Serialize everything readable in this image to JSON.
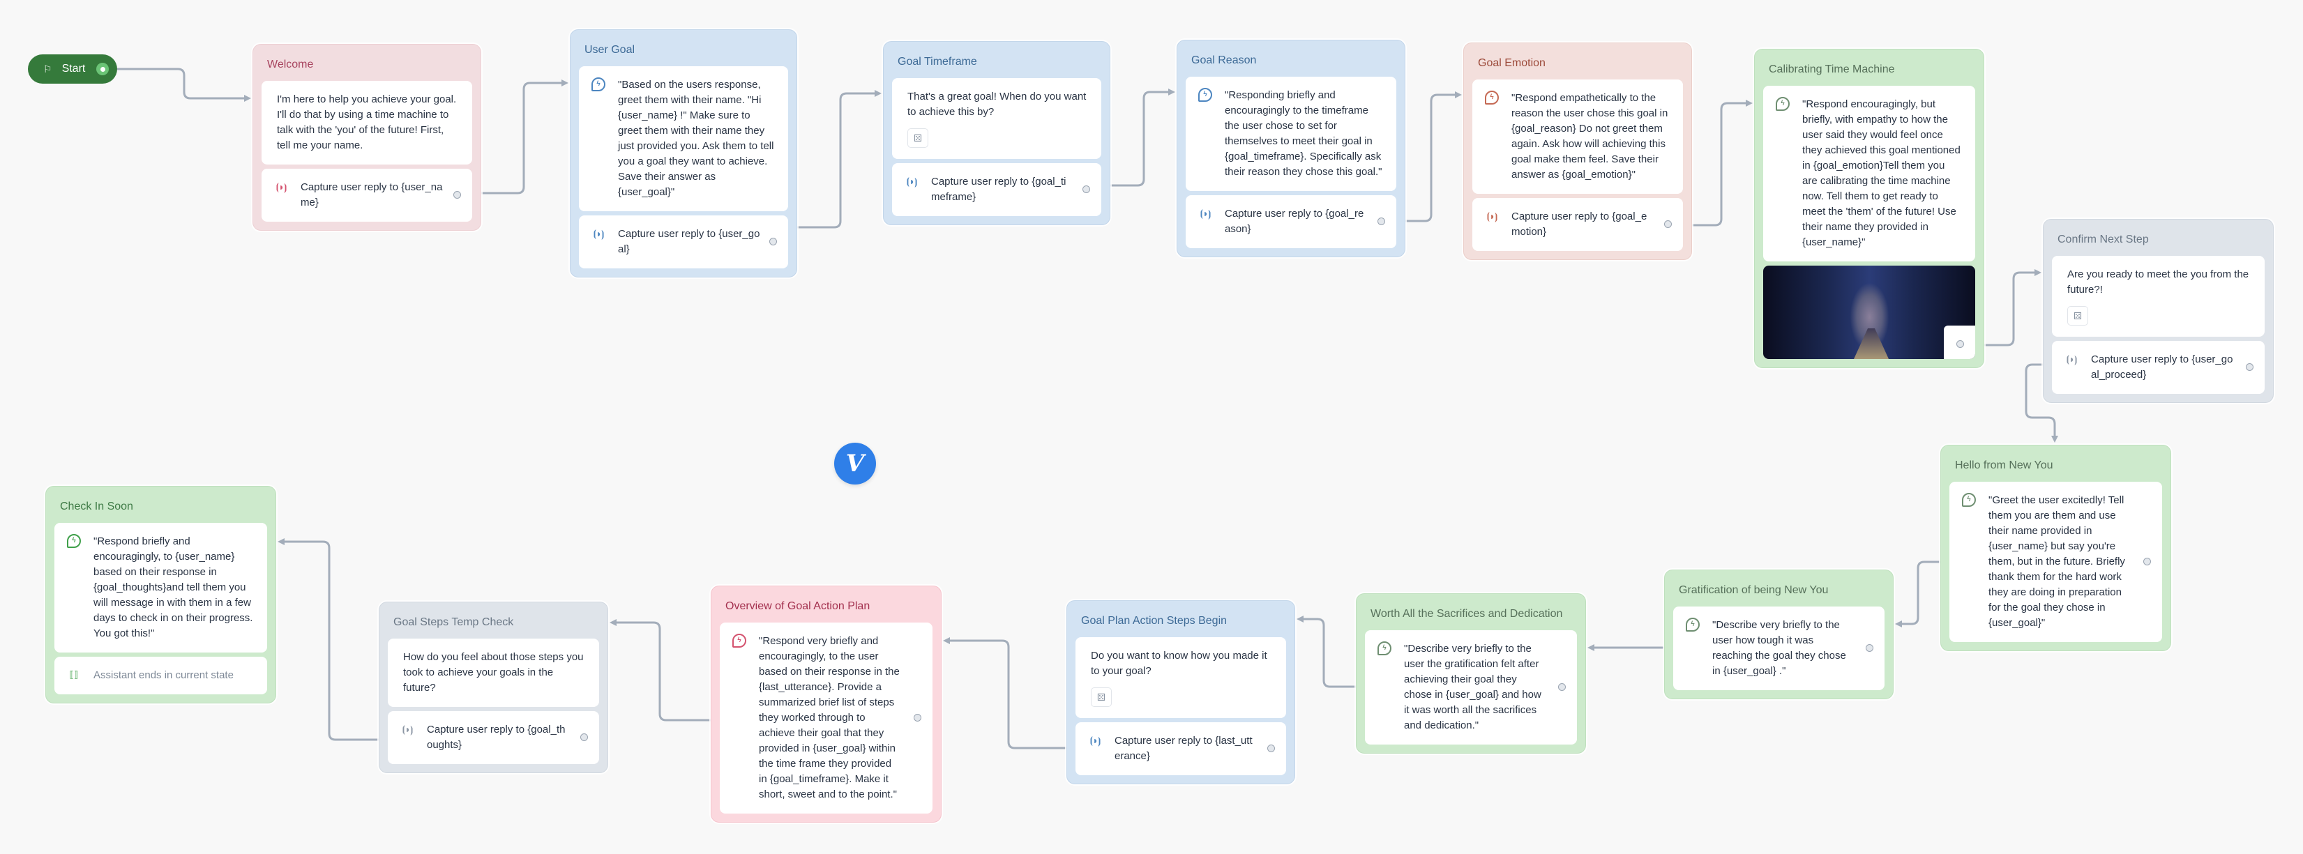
{
  "start": {
    "label": "Start",
    "icon": "flag-icon"
  },
  "logo": {
    "letter": "V"
  },
  "blocks": {
    "welcome": {
      "title": "Welcome",
      "message": "I'm here to help you achieve your goal. I'll do that by using a time machine to talk with the 'you' of the future! First, tell me your name.",
      "capture": "Capture user reply to {user_na me}"
    },
    "user_goal": {
      "title": "User Goal",
      "prompt": "\"Based on the users response, greet them with their name. \"Hi {user_name} !\" Make sure to greet them with their name they just provided you. Ask them to tell you a goal they want to achieve. Save their answer as {user_goal}\"",
      "capture": "Capture user reply to {user_go al}"
    },
    "goal_timeframe": {
      "title": "Goal Timeframe",
      "message": "That's a great goal! When do you want to achieve this by?",
      "capture": "Capture user reply to {goal_ti meframe}"
    },
    "goal_reason": {
      "title": "Goal Reason",
      "prompt": "\"Responding briefly and encouragingly to the timeframe the user chose to set for themselves to meet their goal in {goal_timeframe}. Specifically ask their reason they chose this goal.\"",
      "capture": "Capture user reply to {goal_re ason}"
    },
    "goal_emotion": {
      "title": "Goal Emotion",
      "prompt": "\"Respond empathetically to the reason the user chose this goal in {goal_reason} Do not greet them again. Ask how will achieving this goal make them feel. Save their answer as {goal_emotion}\"",
      "capture": "Capture user reply to {goal_e motion}"
    },
    "calibrating": {
      "title": "Calibrating Time Machine",
      "prompt": "\"Respond encouragingly, but briefly, with empathy to how the user said they would feel once they achieved this goal mentioned in {goal_emotion}Tell them you are calibrating the time machine now. Tell them to get ready to meet the 'them' of the future! Use their name they provided in {user_name}\""
    },
    "confirm_next": {
      "title": "Confirm Next Step",
      "message": "Are you ready to meet the you from the future?!",
      "capture": "Capture user reply to {user_go al_proceed}"
    },
    "hello_new_you": {
      "title": "Hello from New You",
      "prompt": "\"Greet the user excitedly! Tell them you are them and use their name provided in {user_name} but say you're them, but in the future. Briefly thank them for the hard work they are doing in preparation for the goal they chose in {user_goal}\""
    },
    "gratification": {
      "title": "Gratification of being New You",
      "prompt": "\"Describe very briefly to the user how tough it was reaching the goal they chose in {user_goal} .\""
    },
    "worth_all": {
      "title": "Worth All the Sacrifices and Dedication",
      "prompt": "\"Describe very briefly to the user the gratification felt after achieving their goal they chose in {user_goal} and how it was worth all the sacrifices and dedication.\""
    },
    "action_steps": {
      "title": "Goal Plan Action Steps Begin",
      "message": "Do you want to know how you made it to your goal?",
      "capture": "Capture user reply to {last_utt erance}"
    },
    "overview": {
      "title": "Overview of Goal Action Plan",
      "prompt": "\"Respond very briefly and encouragingly, to the user based on their response in the {last_utterance}. Provide a summarized brief list of steps they worked through to achieve their goal that they provided in {user_goal} within the time frame they provided in {goal_timeframe}. Make it short, sweet and to the point.\""
    },
    "temp_check": {
      "title": "Goal Steps Temp Check",
      "message": "How do you feel about those steps you took to achieve your goals in the future?",
      "capture": "Capture user reply to {goal_th oughts}"
    },
    "check_in": {
      "title": "Check In Soon",
      "prompt": "\"Respond briefly and encouragingly, to {user_name} based on their response in {goal_thoughts}and tell them you will message in with them in a few days to check in on their progress. You got this!\"",
      "end": "Assistant ends in current state"
    }
  },
  "colors": {
    "canvas": "#f8f8f8",
    "start": "#357a3b",
    "logo": "#2f7fe8",
    "connector": "#a3adba",
    "icon_blue": "#4d86c0",
    "icon_red": "#d4536f",
    "icon_salmon": "#c56a55",
    "icon_green": "#6f8f72",
    "icon_green_dark": "#3fa04a",
    "icon_grey": "#8a95a3"
  }
}
